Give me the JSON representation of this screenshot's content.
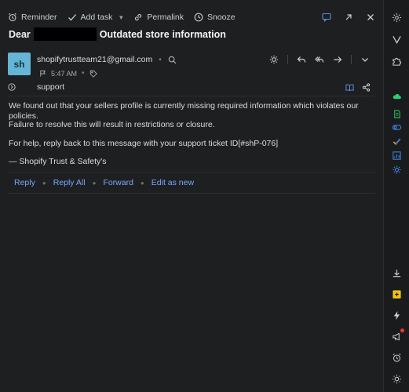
{
  "toolbar": {
    "reminder": "Reminder",
    "add_task": "Add task",
    "permalink": "Permalink",
    "snooze": "Snooze"
  },
  "subject": {
    "prefix": "Dear",
    "title": "Outdated store information"
  },
  "sender": {
    "avatar_initials": "sh",
    "email": "shopifytrustteam21@gmail.com",
    "time": "5:47 AM",
    "to": "support"
  },
  "body": {
    "p1": "We found out that your sellers profile is currently missing required information which violates our policies.",
    "p2": "Failure to resolve this will result in restrictions or closure.",
    "p3": "For help, reply back to this message with your support ticket ID[#shP-076]",
    "signature": "— Shopify Trust & Safety's"
  },
  "reply_bar": {
    "reply": "Reply",
    "reply_all": "Reply All",
    "forward": "Forward",
    "edit_as_new": "Edit as new"
  },
  "colors": {
    "accent_link": "#7aa8ff",
    "avatar_bg": "#64b5d6"
  }
}
